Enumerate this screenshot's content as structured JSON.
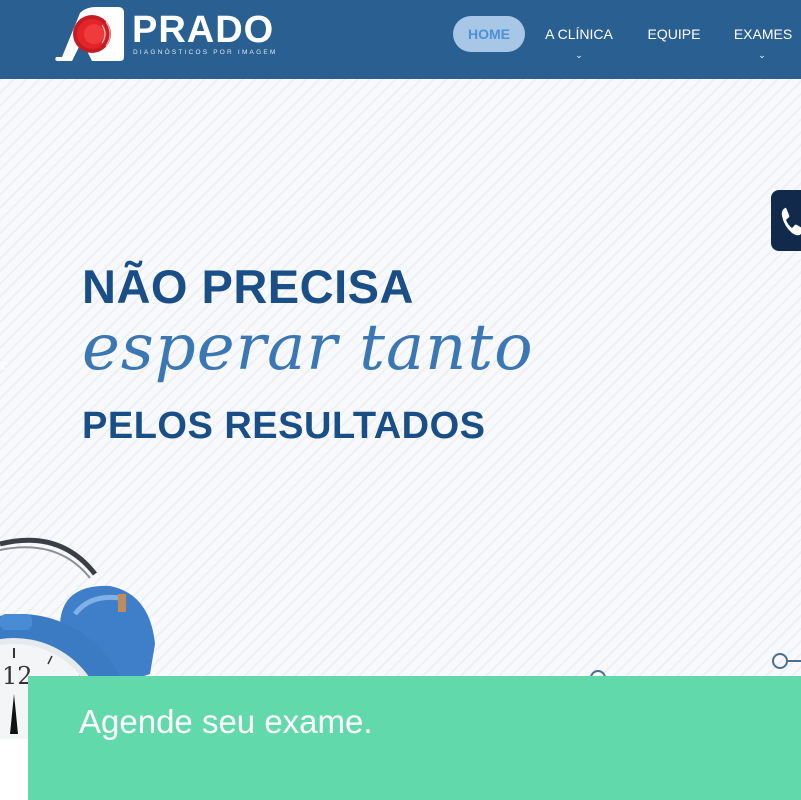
{
  "brand": {
    "name": "PRADO",
    "tagline": "DIAGNÓSTICOS POR IMAGEM",
    "colors": {
      "header": "#2a5f91",
      "accent_red": "#e3242b",
      "cta": "#62d9ab",
      "headline": "#1a4e86"
    }
  },
  "nav": {
    "items": [
      {
        "label": "HOME",
        "active": true,
        "has_dropdown": false
      },
      {
        "label": "A CLÍNICA",
        "active": false,
        "has_dropdown": true
      },
      {
        "label": "EQUIPE",
        "active": false,
        "has_dropdown": false
      },
      {
        "label": "EXAMES",
        "active": false,
        "has_dropdown": true
      }
    ],
    "dropdown_icon": "chevron-down-icon"
  },
  "hero": {
    "line1": "NÃO PRECISA",
    "line2": "esperar tanto",
    "line3": "PELOS RESULTADOS",
    "clock_number": "12",
    "phone_icon": "phone-icon"
  },
  "cta": {
    "label": "Agende seu exame."
  }
}
